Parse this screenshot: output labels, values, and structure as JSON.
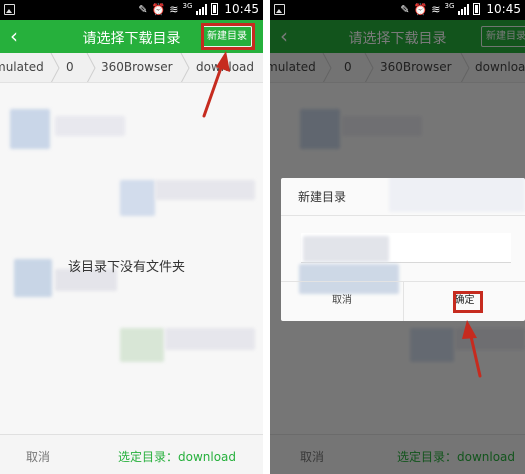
{
  "status_bar": {
    "network_label": "3G",
    "time": "10:45"
  },
  "title_bar": {
    "title": "请选择下载目录",
    "new_dir_button": "新建目录"
  },
  "breadcrumb": {
    "items": [
      "mulated",
      "0",
      "360Browser",
      "download"
    ]
  },
  "content": {
    "empty_message": "该目录下没有文件夹"
  },
  "bottom_bar": {
    "cancel_label": "取消",
    "selected_dir_label": "选定目录：download"
  },
  "dialog": {
    "title": "新建目录",
    "cancel_label": "取消",
    "confirm_label": "确定"
  },
  "colors": {
    "accent_green": "#26b03c",
    "annotation_red": "#c62b1f"
  },
  "icons": [
    "back-arrow-icon",
    "gallery-notification-icon",
    "vibrate-icon",
    "alarm-icon",
    "wifi-icon",
    "signal-icon",
    "battery-icon",
    "breadcrumb-chevron-icon",
    "annotation-arrow-icon"
  ]
}
